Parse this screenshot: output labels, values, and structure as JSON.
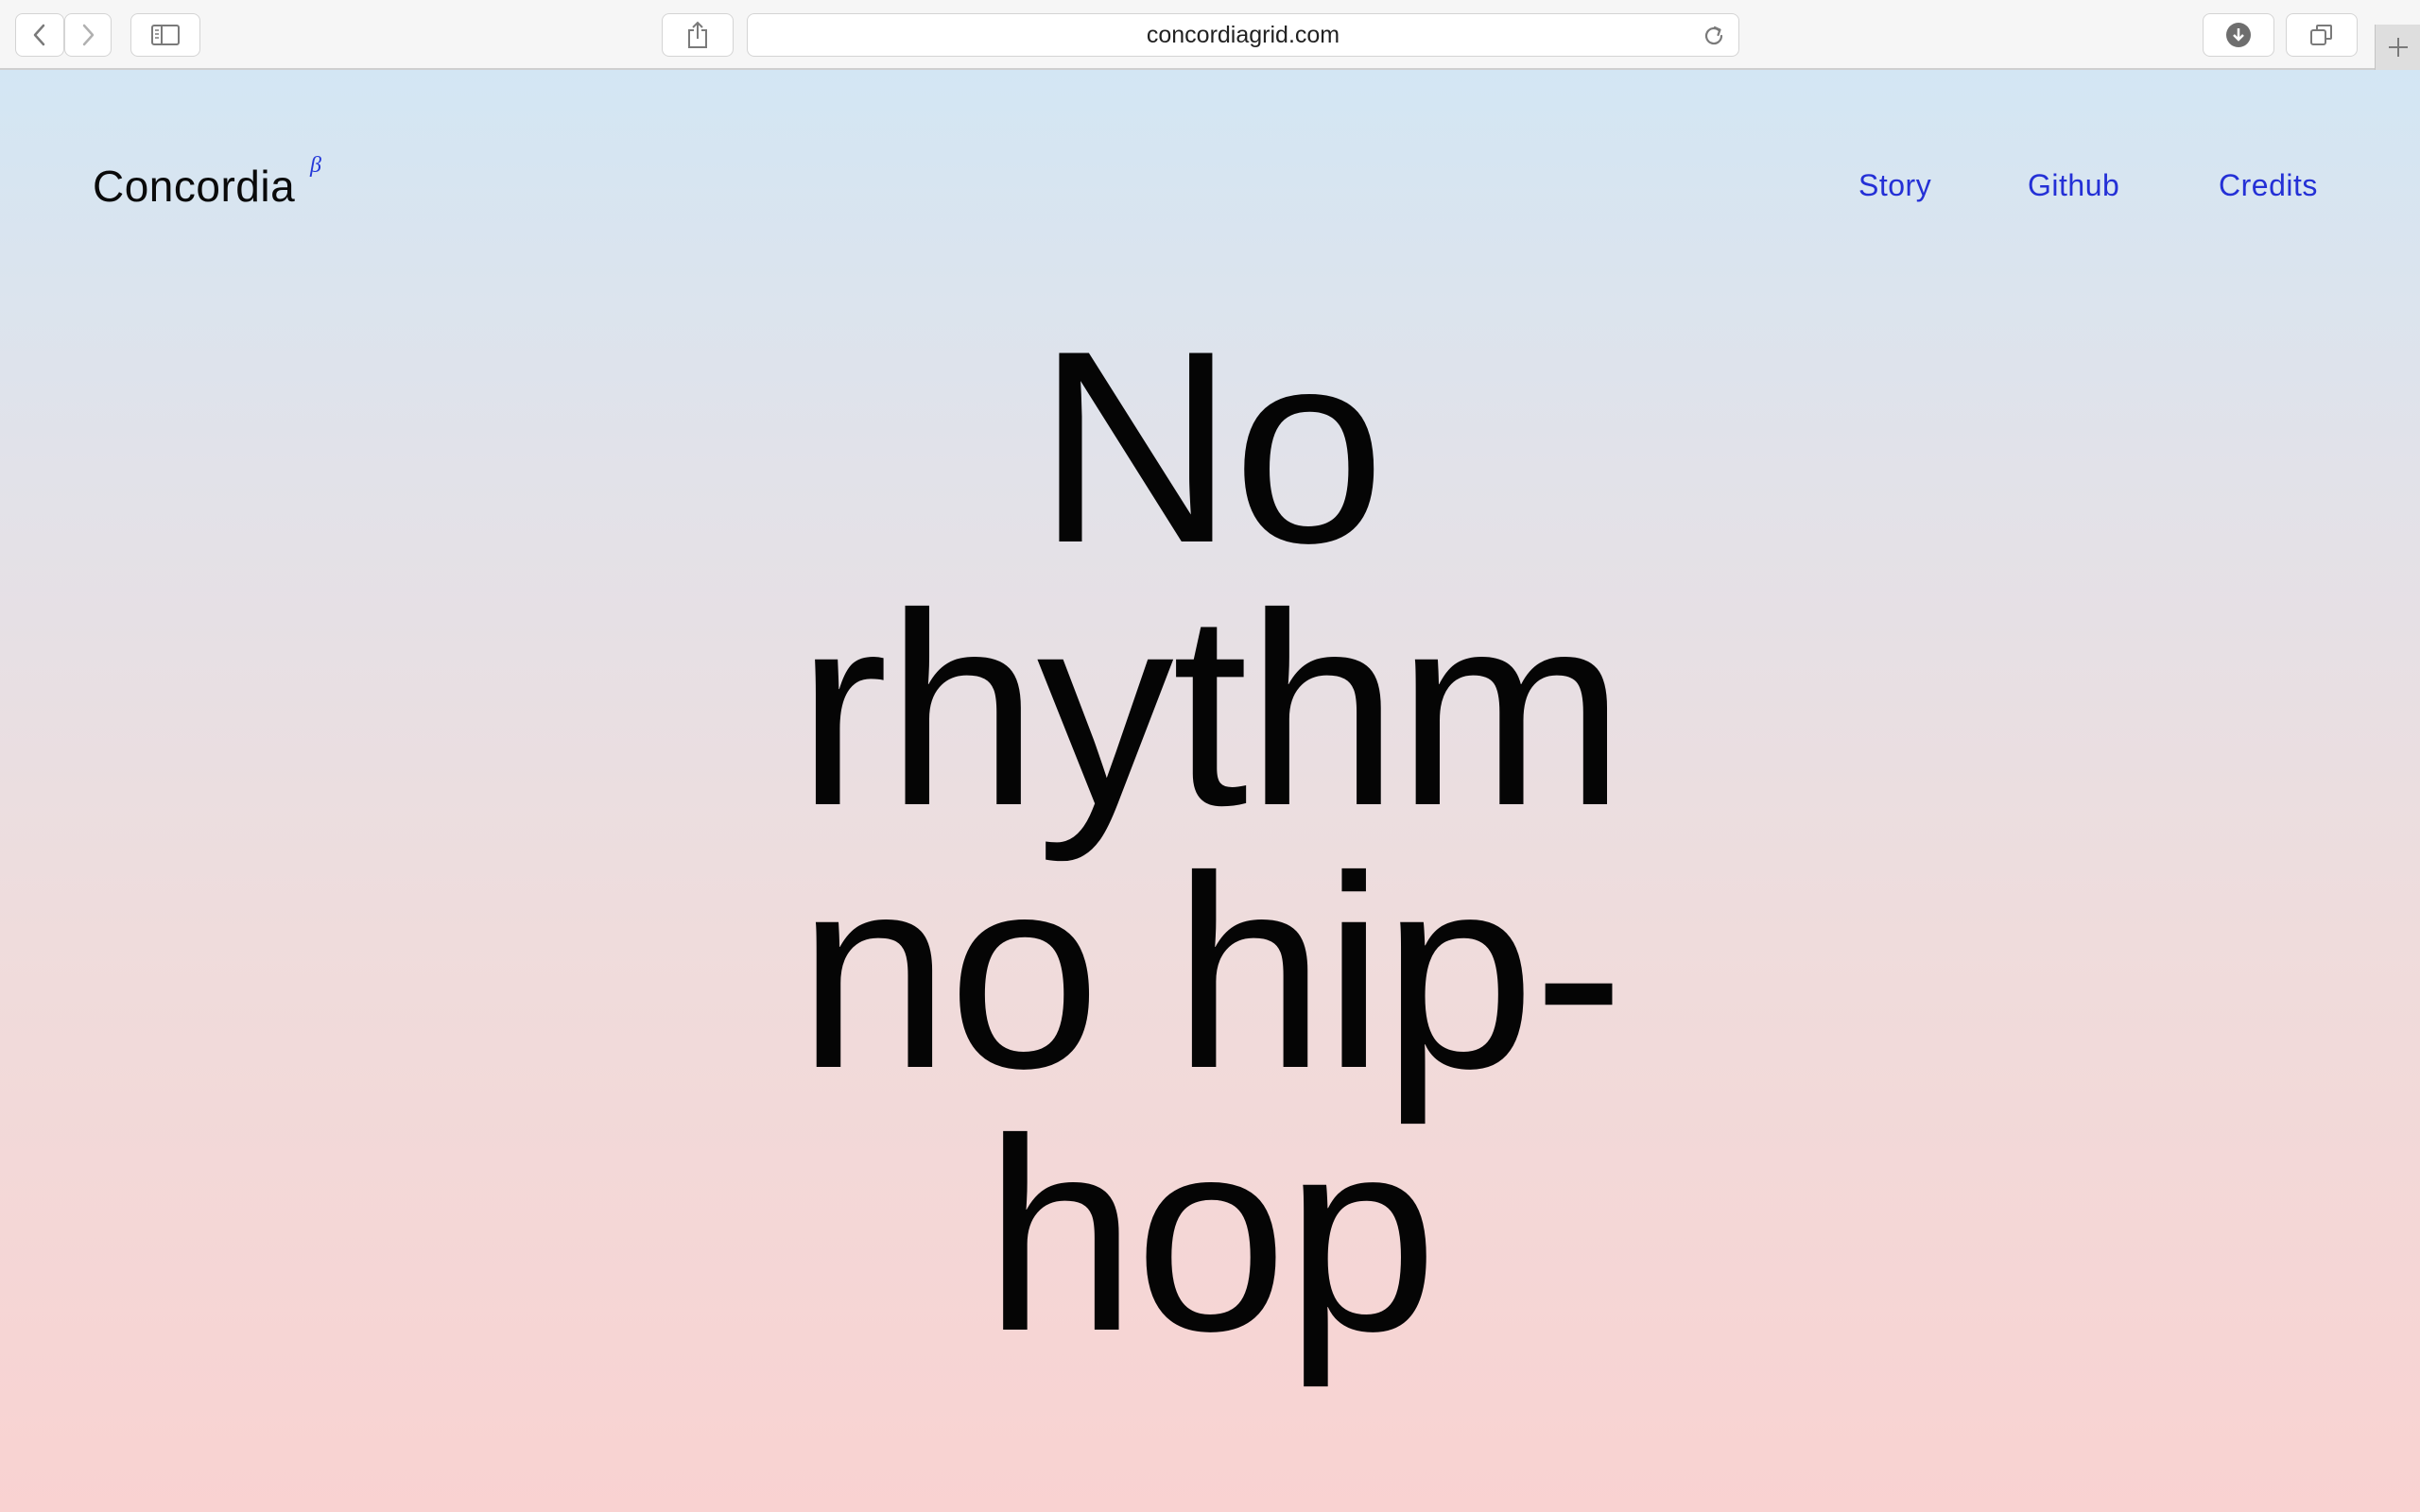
{
  "browser": {
    "url": "concordiagrid.com",
    "icons": {
      "back": "chevron-left-icon",
      "forward": "chevron-right-icon",
      "sidebar": "sidebar-icon",
      "share": "share-icon",
      "reload": "reload-icon",
      "downloads": "download-icon",
      "tabs": "tabs-overview-icon",
      "new_tab": "plus-icon"
    }
  },
  "site": {
    "logo": "Concordia",
    "logo_superscript": "β",
    "nav": [
      {
        "label": "Story"
      },
      {
        "label": "Github"
      },
      {
        "label": "Credits"
      }
    ],
    "hero_lines": [
      "No",
      "rhythm",
      "no hip-",
      "hop"
    ],
    "colors": {
      "accent": "#2430d6",
      "text": "#050505",
      "gradient_top": "#d3e6f4",
      "gradient_bottom": "#f9d2d1"
    }
  }
}
